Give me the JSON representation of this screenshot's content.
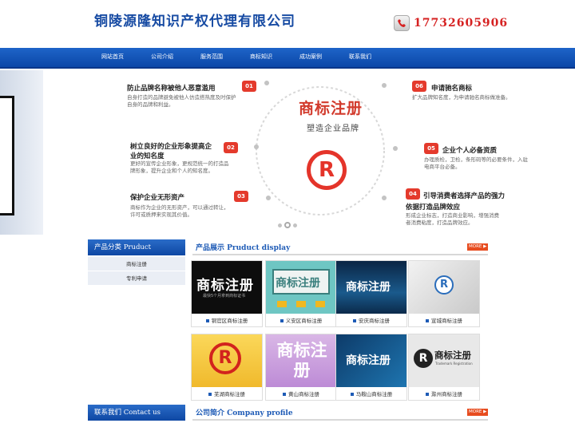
{
  "header": {
    "site_title": "铜陵源隆知识产权代理有限公司",
    "phone": "17732605906"
  },
  "nav": {
    "items": [
      "网站首页",
      "公司介绍",
      "服务范围",
      "商标知识",
      "成功案例",
      "联系我们"
    ]
  },
  "banner": {
    "center_title": "商标注册",
    "center_subtitle": "塑造企业品牌",
    "center_symbol": "R",
    "features": [
      {
        "num": "01",
        "title": "防止品牌名称被他人恶意滥用",
        "desc": [
          "自身打造的品牌避免被他人仿造搭热度及时保护",
          "自身的品牌和利益。"
        ]
      },
      {
        "num": "02",
        "title": "树立良好的企业形象提高企",
        "title2": "业的知名度",
        "desc": [
          "更好的宣传企业形象，更规范统一的打造品",
          "牌形象，提升企业和个人的知名度。"
        ]
      },
      {
        "num": "03",
        "title": "保护企业无形资产",
        "desc": [
          "商标作为企业的无形资产，可以通过转让，",
          "许可或质押来实现其价值。"
        ]
      },
      {
        "num": "06",
        "title": "申请驰名商标",
        "desc": [
          "扩大品牌知名度，为申请驰名商标做准备。"
        ]
      },
      {
        "num": "05",
        "title": "企业个人必备资质",
        "desc": [
          "办理质检，卫检，条形码等的必要条件，入驻",
          "电商平台必备。"
        ]
      },
      {
        "num": "04",
        "title": "引导消费者选择产品的强力",
        "title2": "依据打造品牌效应",
        "desc": [
          "形成企业标志，打造商业影响，增强消费",
          "者消费粘度，打造品牌效应。"
        ]
      }
    ],
    "accent_color": "#e43a2c"
  },
  "sidebar": {
    "title": "产品分类 Pruduct",
    "items": [
      "商标注册",
      "专利申请"
    ]
  },
  "products": {
    "title": "产品展示 Pruduct display",
    "more": "MORE",
    "items": [
      {
        "caption": "铜官区商标注册",
        "text": "商标注册",
        "sub": "最快5个月拿到商标证书"
      },
      {
        "caption": "义安区商标注册",
        "text": "商标注册"
      },
      {
        "caption": "安庆商标注册",
        "text": "商标注册"
      },
      {
        "caption": "宣城商标注册",
        "text": "R"
      },
      {
        "caption": "芜湖商标注册",
        "text": "R"
      },
      {
        "caption": "黄山商标注册",
        "text": "商标注册"
      },
      {
        "caption": "马鞍山商标注册",
        "text": "商标注册"
      },
      {
        "caption": "滁州商标注册",
        "text": "商标注册",
        "sub": "Trademark Registration"
      }
    ]
  },
  "contact": {
    "title": "联系我们 Contact us"
  },
  "company": {
    "title": "公司简介 Company profile",
    "more": "MORE"
  }
}
